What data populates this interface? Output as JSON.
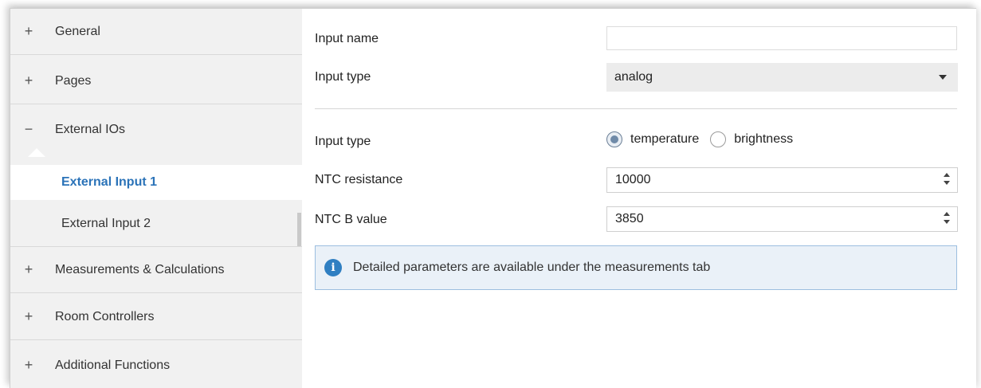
{
  "sidebar": {
    "items": [
      {
        "sign": "+",
        "label": "General"
      },
      {
        "sign": "+",
        "label": "Pages"
      },
      {
        "sign": "−",
        "label": "External IOs"
      },
      {
        "sign": "+",
        "label": "Measurements & Calculations"
      },
      {
        "sign": "+",
        "label": "Room Controllers"
      },
      {
        "sign": "+",
        "label": "Additional Functions"
      }
    ],
    "subitems": [
      {
        "label": "External Input 1",
        "active": true
      },
      {
        "label": "External Input 2",
        "active": false
      }
    ]
  },
  "form": {
    "input_name_label": "Input name",
    "input_name_value": "",
    "input_type_label": "Input type",
    "input_type_value": "analog",
    "sensor_type_label": "Input type",
    "sensor_type_options": [
      "temperature",
      "brightness"
    ],
    "sensor_type_selected": "temperature",
    "ntc_resistance_label": "NTC resistance",
    "ntc_resistance_value": "10000",
    "ntc_b_label": "NTC B value",
    "ntc_b_value": "3850",
    "info_text": "Detailed parameters are available under the measurements tab"
  },
  "colors": {
    "accent": "#2b73b8",
    "info_icon": "#2f7fc2",
    "info_bg": "#eaf1f8",
    "sidebar_bg": "#f1f1f1"
  }
}
